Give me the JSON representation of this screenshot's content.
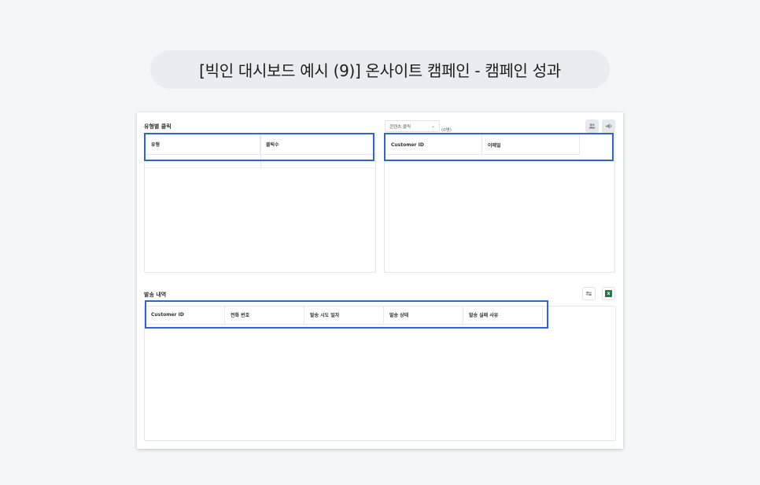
{
  "page_title": "[빅인 대시보드 예시 (9)] 온사이트 캠페인 - 캠페인 성과",
  "click_by_type": {
    "title": "유형별 클릭",
    "columns": [
      "유형",
      "클릭수"
    ]
  },
  "content_click": {
    "select_value": "콘텐츠 클릭",
    "count": "(0명)",
    "columns": [
      "Customer ID",
      "이메일"
    ],
    "icons": [
      "users-icon",
      "megaphone-icon"
    ]
  },
  "send_history": {
    "title": "발송 내역",
    "columns": [
      "Customer ID",
      "전화 번호",
      "발송 시도 일자",
      "발송 상태",
      "발송 실패 사유"
    ],
    "icons": [
      "filter-sliders-icon",
      "excel-icon"
    ]
  },
  "colors": {
    "highlight": "#2f63d8",
    "excel": "#1f7a43"
  }
}
